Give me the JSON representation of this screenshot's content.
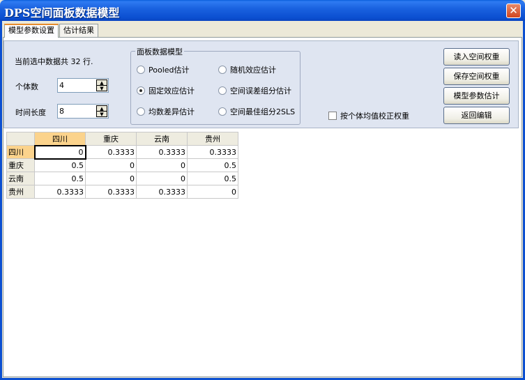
{
  "window": {
    "title": "DPS空间面板数据模型",
    "close_label": "✕"
  },
  "tabs": [
    {
      "label": "模型参数设置",
      "active": true
    },
    {
      "label": "估计结果",
      "active": false
    }
  ],
  "params": {
    "summary": "当前选中数据共 32 行.",
    "individuals_label": "个体数",
    "individuals_value": "4",
    "time_label": "时间长度",
    "time_value": "8"
  },
  "model_group": {
    "title": "面板数据模型",
    "options": [
      {
        "label": "Pooled估计",
        "selected": false
      },
      {
        "label": "随机效应估计",
        "selected": false
      },
      {
        "label": "固定效应估计",
        "selected": true
      },
      {
        "label": "空间误差组分估计",
        "selected": false
      },
      {
        "label": "均数差异估计",
        "selected": false
      },
      {
        "label": "空间最佳组分2SLS",
        "selected": false
      }
    ]
  },
  "checkbox": {
    "label": "按个体均值校正权重",
    "checked": false
  },
  "buttons": {
    "read_weights": "读入空间权重",
    "save_weights": "保存空间权重",
    "estimate": "模型参数估计",
    "back": "返回编辑"
  },
  "grid": {
    "columns": [
      "四川",
      "重庆",
      "云南",
      "贵州"
    ],
    "rows": [
      {
        "label": "四川",
        "cells": [
          "0",
          "0.3333",
          "0.3333",
          "0.3333"
        ]
      },
      {
        "label": "重庆",
        "cells": [
          "0.5",
          "0",
          "0",
          "0.5"
        ]
      },
      {
        "label": "云南",
        "cells": [
          "0.5",
          "0",
          "0",
          "0.5"
        ]
      },
      {
        "label": "贵州",
        "cells": [
          "0.3333",
          "0.3333",
          "0.3333",
          "0"
        ]
      }
    ]
  }
}
